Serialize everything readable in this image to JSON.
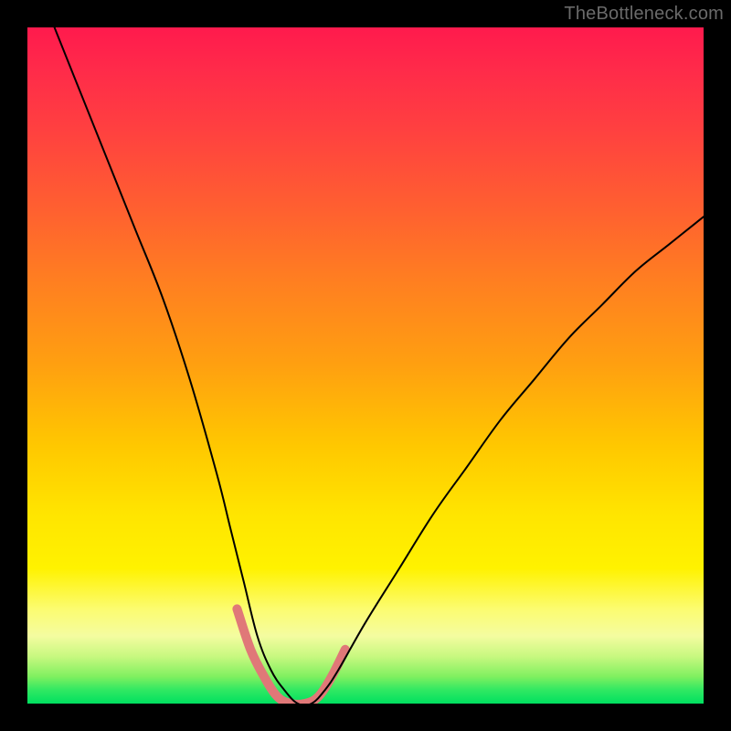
{
  "watermark": "TheBottleneck.com",
  "chart_data": {
    "type": "line",
    "title": "",
    "xlabel": "",
    "ylabel": "",
    "xlim": [
      0,
      100
    ],
    "ylim": [
      0,
      100
    ],
    "grid": false,
    "annotations": [],
    "background_gradient": {
      "direction": "vertical",
      "stops": [
        {
          "pos": 0,
          "color": "#ff1a4d"
        },
        {
          "pos": 50,
          "color": "#ffa010"
        },
        {
          "pos": 80,
          "color": "#fff200"
        },
        {
          "pos": 100,
          "color": "#00e060"
        }
      ]
    },
    "series": [
      {
        "name": "main-curve",
        "color": "#000000",
        "width": 2,
        "x": [
          4,
          8,
          12,
          16,
          20,
          24,
          28,
          30,
          32,
          34,
          36,
          38,
          40,
          42,
          44,
          46,
          50,
          55,
          60,
          65,
          70,
          75,
          80,
          85,
          90,
          95,
          100
        ],
        "y": [
          100,
          90,
          80,
          70,
          60,
          48,
          34,
          26,
          18,
          10,
          5,
          2,
          0,
          0,
          2,
          5,
          12,
          20,
          28,
          35,
          42,
          48,
          54,
          59,
          64,
          68,
          72
        ]
      },
      {
        "name": "bottom-highlight",
        "color": "#e07878",
        "width": 10,
        "x": [
          31,
          33,
          35,
          37,
          39,
          41,
          43,
          45,
          47
        ],
        "y": [
          14,
          8,
          4,
          1,
          0,
          0,
          1,
          4,
          8
        ]
      }
    ]
  }
}
